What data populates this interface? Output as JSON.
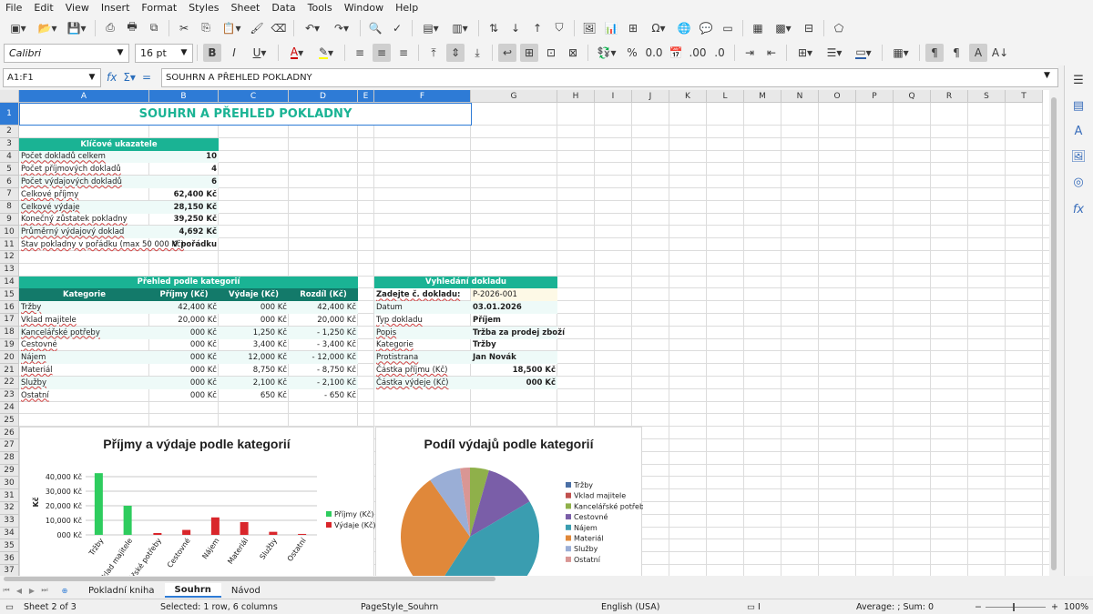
{
  "menu": [
    "File",
    "Edit",
    "View",
    "Insert",
    "Format",
    "Styles",
    "Sheet",
    "Data",
    "Tools",
    "Window",
    "Help"
  ],
  "toolbar": {
    "font_name": "Calibri",
    "font_size": "16 pt"
  },
  "formula_bar": {
    "cell_ref": "A1:F1",
    "content": "SOUHRN A PŘEHLED POKLADNY"
  },
  "columns": [
    "A",
    "B",
    "C",
    "D",
    "E",
    "F",
    "G",
    "H",
    "I",
    "J",
    "K",
    "L",
    "M",
    "N",
    "O",
    "P",
    "Q",
    "R",
    "S",
    "T"
  ],
  "rows": [
    "1",
    "2",
    "3",
    "4",
    "5",
    "6",
    "7",
    "8",
    "9",
    "10",
    "11",
    "12",
    "13",
    "14",
    "15",
    "16",
    "17",
    "18",
    "19",
    "20",
    "21",
    "22",
    "23",
    "24",
    "25",
    "26",
    "27",
    "28",
    "29",
    "30",
    "31",
    "32",
    "33",
    "34",
    "35",
    "36",
    "37"
  ],
  "sheet": {
    "title": "SOUHRN A PŘEHLED POKLADNY",
    "kpi": {
      "header": "Klíčové ukazatele",
      "rows": [
        {
          "label": "Počet dokladů celkem",
          "value": "10"
        },
        {
          "label": "Počet příjmových dokladů",
          "value": "4"
        },
        {
          "label": "Počet výdajových dokladů",
          "value": "6"
        },
        {
          "label": "Celkové příjmy",
          "value": "62,400 Kč"
        },
        {
          "label": "Celkové výdaje",
          "value": "28,150 Kč"
        },
        {
          "label": "Konečný zůstatek pokladny",
          "value": "39,250 Kč"
        },
        {
          "label": "Průměrný výdajový doklad",
          "value": "4,692 Kč"
        },
        {
          "label": "Stav pokladny v pořádku (max 50 000 Kč)",
          "value": "V pořádku"
        }
      ]
    },
    "categories": {
      "header": "Přehled podle kategorií",
      "columns": [
        "Kategorie",
        "Příjmy (Kč)",
        "Výdaje (Kč)",
        "Rozdíl (Kč)"
      ],
      "rows": [
        [
          "Tržby",
          "42,400 Kč",
          "000 Kč",
          "42,400 Kč"
        ],
        [
          "Vklad majitele",
          "20,000 Kč",
          "000 Kč",
          "20,000 Kč"
        ],
        [
          "Kancelářské potřeby",
          "000 Kč",
          "1,250 Kč",
          "- 1,250 Kč"
        ],
        [
          "Cestovné",
          "000 Kč",
          "3,400 Kč",
          "- 3,400 Kč"
        ],
        [
          "Nájem",
          "000 Kč",
          "12,000 Kč",
          "- 12,000 Kč"
        ],
        [
          "Materiál",
          "000 Kč",
          "8,750 Kč",
          "- 8,750 Kč"
        ],
        [
          "Služby",
          "000 Kč",
          "2,100 Kč",
          "- 2,100 Kč"
        ],
        [
          "Ostatní",
          "000 Kč",
          "650 Kč",
          "- 650 Kč"
        ]
      ]
    },
    "lookup": {
      "header": "Vyhledání dokladu",
      "rows": [
        {
          "label": "Zadejte č. dokladu:",
          "value": "P-2026-001"
        },
        {
          "label": "Datum",
          "value": "03.01.2026"
        },
        {
          "label": "Typ dokladu",
          "value": "Příjem"
        },
        {
          "label": "Popis",
          "value": "Tržba za prodej zboží"
        },
        {
          "label": "Kategorie",
          "value": "Tržby"
        },
        {
          "label": "Protistrana",
          "value": "Jan Novák"
        },
        {
          "label": "Částka příjmu (Kč)",
          "value": "18,500 Kč"
        },
        {
          "label": "Částka výdeje (Kč)",
          "value": "000 Kč"
        }
      ]
    }
  },
  "chart_data": [
    {
      "type": "bar",
      "title": "Příjmy a výdaje podle kategorií",
      "ylabel": "Kč",
      "categories": [
        "Tržby",
        "Vklad majitele",
        "Kancelářské potřeby",
        "Cestovné",
        "Nájem",
        "Materiál",
        "Služby",
        "Ostatní"
      ],
      "yticks": [
        "000 Kč",
        "10,000 Kč",
        "20,000 Kč",
        "30,000 Kč",
        "40,000 Kč"
      ],
      "ylim": [
        0,
        45000
      ],
      "series": [
        {
          "name": "Příjmy (Kč)",
          "color": "#2ecc5e",
          "values": [
            42400,
            20000,
            0,
            0,
            0,
            0,
            0,
            0
          ]
        },
        {
          "name": "Výdaje (Kč)",
          "color": "#d9262b",
          "values": [
            0,
            0,
            1250,
            3400,
            12000,
            8750,
            2100,
            650
          ]
        }
      ],
      "legend": "right",
      "grid": true
    },
    {
      "type": "pie",
      "title": "Podíl výdajů podle kategorií",
      "categories": [
        "Tržby",
        "Vklad majitele",
        "Kancelářské potřeby",
        "Cestovné",
        "Nájem",
        "Materiál",
        "Služby",
        "Ostatní"
      ],
      "values": [
        0,
        0,
        1250,
        3400,
        12000,
        8750,
        2100,
        650
      ],
      "colors": [
        "#4a6fa5",
        "#c0504d",
        "#8fb04a",
        "#7a5ea8",
        "#3a9db0",
        "#e0883a",
        "#9aaed6",
        "#d99694"
      ],
      "legend": "right"
    }
  ],
  "tabs": [
    "Pokladní kniha",
    "Souhrn",
    "Návod"
  ],
  "active_tab": "Souhrn",
  "status": {
    "sheet": "Sheet 2 of 3",
    "selection": "Selected: 1 row, 6 columns",
    "page_style": "PageStyle_Souhrn",
    "language": "English (USA)",
    "summary": "Average: ; Sum: 0",
    "zoom": "100%"
  }
}
